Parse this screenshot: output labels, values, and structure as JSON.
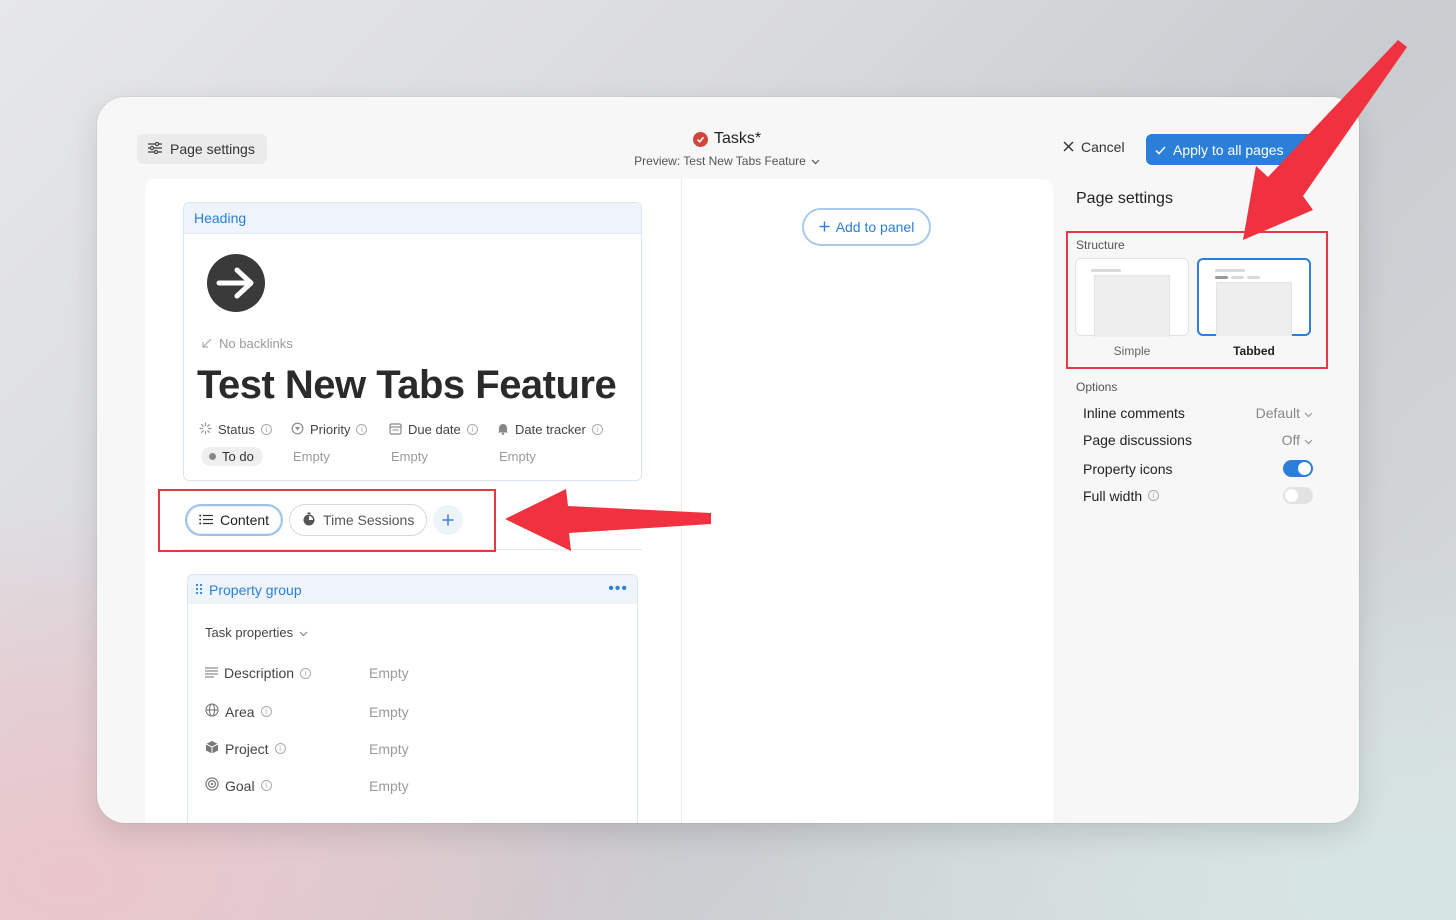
{
  "header": {
    "page_settings_label": "Page settings",
    "title": "Tasks*",
    "preview_label": "Preview: Test New Tabs Feature",
    "cancel_label": "Cancel",
    "apply_label": "Apply to all pages"
  },
  "heading_card": {
    "section_label": "Heading",
    "backlinks_label": "No backlinks",
    "page_title": "Test New Tabs Feature",
    "properties": [
      {
        "label": "Status",
        "value": "To do",
        "icon": "status-icon"
      },
      {
        "label": "Priority",
        "value": "Empty",
        "icon": "priority-icon"
      },
      {
        "label": "Due date",
        "value": "Empty",
        "icon": "calendar-icon"
      },
      {
        "label": "Date tracker",
        "value": "Empty",
        "icon": "bell-icon"
      }
    ]
  },
  "tabs": [
    {
      "label": "Content",
      "icon": "list-icon",
      "active": true
    },
    {
      "label": "Time Sessions",
      "icon": "stopwatch-icon",
      "active": false
    }
  ],
  "property_group": {
    "title": "Property group",
    "subgroup_label": "Task properties",
    "rows": [
      {
        "label": "Description",
        "value": "Empty",
        "icon": "text-lines-icon"
      },
      {
        "label": "Area",
        "value": "Empty",
        "icon": "globe-icon"
      },
      {
        "label": "Project",
        "value": "Empty",
        "icon": "box-icon"
      },
      {
        "label": "Goal",
        "value": "Empty",
        "icon": "target-icon"
      }
    ]
  },
  "add_panel_label": "Add to panel",
  "sidebar": {
    "title": "Page settings",
    "structure_label": "Structure",
    "structures": [
      {
        "label": "Simple",
        "selected": false
      },
      {
        "label": "Tabbed",
        "selected": true
      }
    ],
    "options_label": "Options",
    "options": [
      {
        "label": "Inline comments",
        "value": "Default",
        "kind": "dropdown"
      },
      {
        "label": "Page discussions",
        "value": "Off",
        "kind": "dropdown"
      },
      {
        "label": "Property icons",
        "kind": "toggle",
        "on": true
      },
      {
        "label": "Full width",
        "kind": "toggle",
        "on": false
      }
    ]
  },
  "colors": {
    "accent": "#2b7fd8",
    "annotation": "#e63946",
    "status_check": "#d3453a"
  }
}
